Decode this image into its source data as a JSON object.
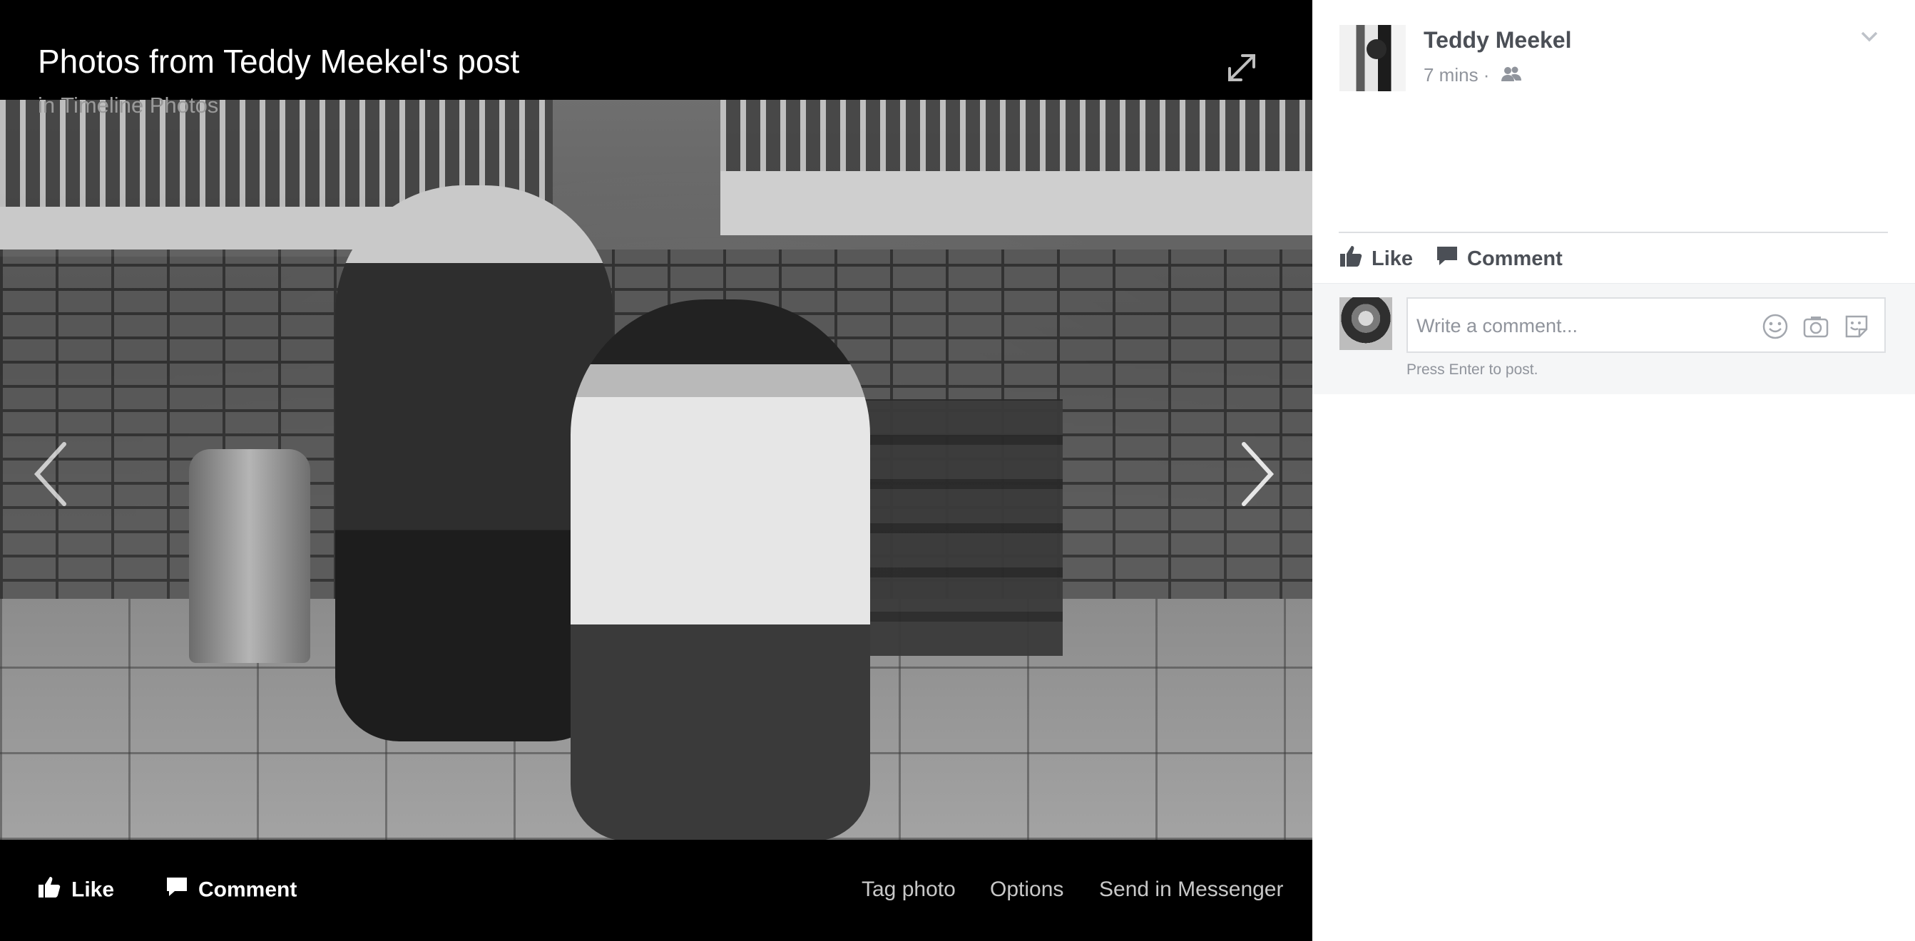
{
  "viewer": {
    "title": "Photos from Teddy Meekel's post",
    "subtitle_prefix": "in ",
    "album": "Timeline Photos",
    "photo_alt": "Black and white photo of two young women making hand gestures in front of a wooden bench and brick wall"
  },
  "bottom_bar": {
    "like_label": "Like",
    "comment_label": "Comment",
    "tag_label": "Tag photo",
    "options_label": "Options",
    "send_label": "Send in Messenger"
  },
  "post": {
    "author": "Teddy Meekel",
    "time": "7 mins",
    "separator": " · ",
    "audience_icon": "friends-icon"
  },
  "actions": {
    "like_label": "Like",
    "comment_label": "Comment"
  },
  "comment": {
    "placeholder": "Write a comment...",
    "hint": "Press Enter to post."
  },
  "colors": {
    "stage_bg": "#000000",
    "panel_bg": "#ffffff",
    "text_dark": "#4b4f56",
    "text_muted": "#90949c"
  }
}
